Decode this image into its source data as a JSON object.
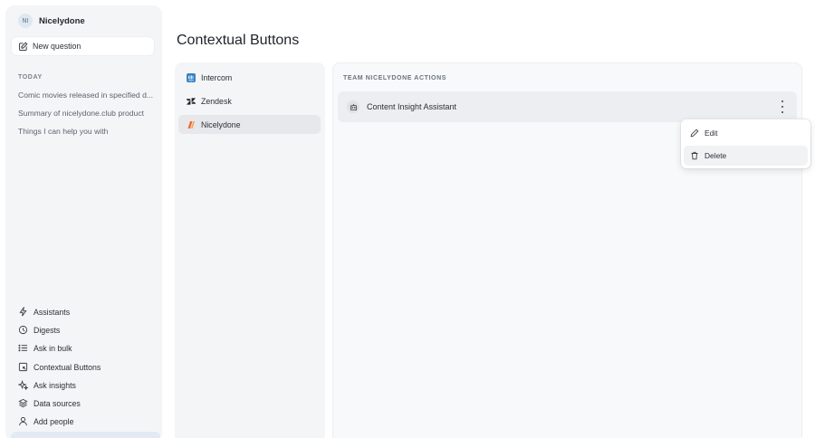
{
  "workspace": {
    "initials": "NI",
    "name": "Nicelydone"
  },
  "new_question": {
    "label": "New question"
  },
  "history": {
    "section_label": "TODAY",
    "items": [
      "Comic movies released in specified d...",
      "Summary of nicelydone.club product",
      "Things I can help you with"
    ]
  },
  "nav": {
    "items": [
      {
        "label": "Assistants",
        "icon": "lightning-icon"
      },
      {
        "label": "Digests",
        "icon": "digest-icon"
      },
      {
        "label": "Ask in bulk",
        "icon": "list-icon"
      },
      {
        "label": "Contextual Buttons",
        "icon": "contextual-button-icon"
      },
      {
        "label": "Ask insights",
        "icon": "sparkle-icon"
      },
      {
        "label": "Data sources",
        "icon": "layers-icon"
      },
      {
        "label": "Add people",
        "icon": "person-icon"
      }
    ]
  },
  "page": {
    "title": "Contextual Buttons"
  },
  "integrations": {
    "selected": "Nicelydone",
    "items": [
      {
        "label": "Intercom",
        "icon": "intercom-icon"
      },
      {
        "label": "Zendesk",
        "icon": "zendesk-icon"
      },
      {
        "label": "Nicelydone",
        "icon": "nicelydone-icon"
      }
    ]
  },
  "actions": {
    "section_label": "TEAM NICELYDONE ACTIONS",
    "items": [
      {
        "label": "Content Insight Assistant",
        "icon": "bot-icon"
      }
    ]
  },
  "context_menu": {
    "items": [
      {
        "label": "Edit",
        "icon": "pencil-icon"
      },
      {
        "label": "Delete",
        "icon": "trash-icon"
      }
    ]
  },
  "colors": {
    "accent_orange": "#f26b2a",
    "intercom_blue": "#3b82c4",
    "selected_bg": "#e6e8ec",
    "hover_bg": "#f1f2f4"
  }
}
